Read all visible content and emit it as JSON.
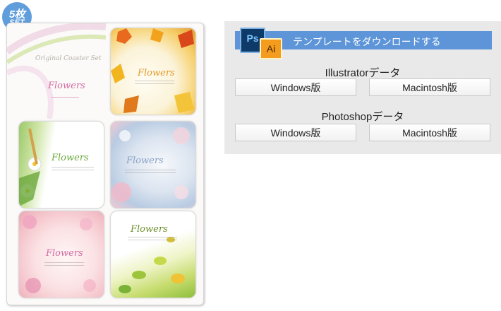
{
  "badge": {
    "count": "5枚",
    "label": "SET"
  },
  "sheet": {
    "subtitle": "Original Coaster Set",
    "cards": [
      {
        "title": "Flowers"
      },
      {
        "title": "Flowers"
      },
      {
        "title": "Flowers"
      },
      {
        "title": "Flowers"
      },
      {
        "title": "Flowers"
      },
      {
        "title": "Flowers"
      }
    ]
  },
  "panel": {
    "banner_text": "テンプレートをダウンロードする",
    "ps_label": "Ps",
    "ai_label": "Ai",
    "illustrator": {
      "heading": "Illustratorデータ",
      "windows": "Windows版",
      "mac": "Macintosh版"
    },
    "photoshop": {
      "heading": "Photoshopデータ",
      "windows": "Windows版",
      "mac": "Macintosh版"
    }
  },
  "colors": {
    "accent": "#5d95d8",
    "panel_bg": "#e9e9e9",
    "badge": "#5f9edb"
  }
}
